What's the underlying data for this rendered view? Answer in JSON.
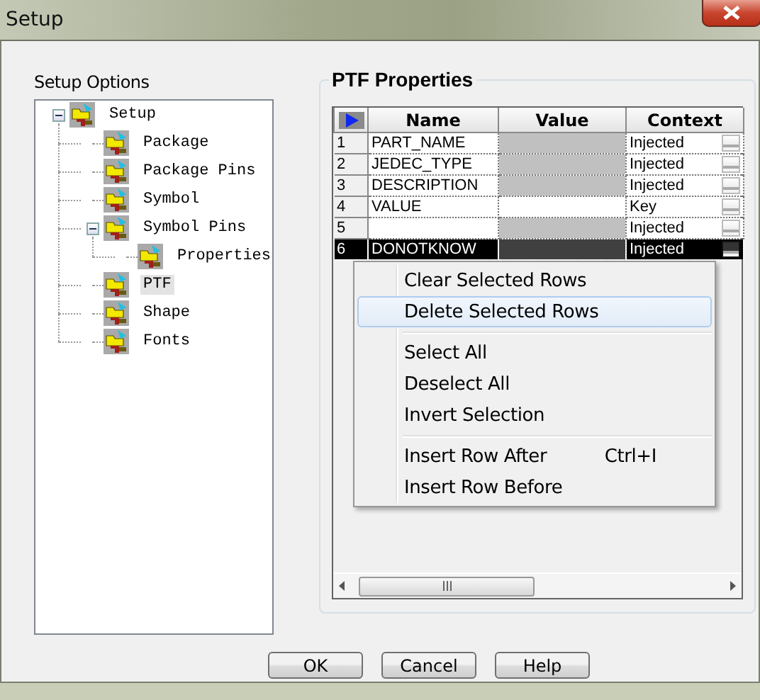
{
  "window": {
    "title": "Setup"
  },
  "setup_options": {
    "label": "Setup Options",
    "tree": [
      {
        "label": "Setup",
        "selected": false,
        "expanded": true,
        "children": [
          {
            "label": "Package",
            "selected": false
          },
          {
            "label": "Package Pins",
            "selected": false
          },
          {
            "label": "Symbol",
            "selected": false
          },
          {
            "label": "Symbol Pins",
            "selected": false,
            "expanded": true,
            "children": [
              {
                "label": "Properties",
                "selected": false
              }
            ]
          },
          {
            "label": "PTF",
            "selected": true
          },
          {
            "label": "Shape",
            "selected": false
          },
          {
            "label": "Fonts",
            "selected": false
          }
        ]
      }
    ]
  },
  "ptf_properties": {
    "title": "PTF Properties",
    "columns": [
      "Name",
      "Value",
      "Context"
    ],
    "rows": [
      {
        "number": "1",
        "name": "PART_NAME",
        "value_disabled": true,
        "context": "Injected",
        "selected": false
      },
      {
        "number": "2",
        "name": "JEDEC_TYPE",
        "value_disabled": true,
        "context": "Injected",
        "selected": false
      },
      {
        "number": "3",
        "name": "DESCRIPTION",
        "value_disabled": true,
        "context": "Injected",
        "selected": false
      },
      {
        "number": "4",
        "name": "VALUE",
        "value_disabled": false,
        "context": "Key",
        "selected": false
      },
      {
        "number": "5",
        "value_disabled": true,
        "context": "Injected",
        "selected": false
      },
      {
        "number": "6",
        "name": "DONOTKNOW",
        "value_disabled": true,
        "context": "Injected",
        "selected": true
      }
    ]
  },
  "context_menu": {
    "items": [
      {
        "kind": "item",
        "label": "Clear Selected Rows",
        "highlighted": false
      },
      {
        "kind": "item",
        "label": "Delete Selected Rows",
        "highlighted": true
      },
      {
        "kind": "separator"
      },
      {
        "kind": "item",
        "label": "Select All",
        "highlighted": false
      },
      {
        "kind": "item",
        "label": "Deselect All",
        "highlighted": false
      },
      {
        "kind": "item",
        "label": "Invert Selection",
        "highlighted": false
      },
      {
        "kind": "separator"
      },
      {
        "kind": "item",
        "label": "Insert Row After",
        "shortcut": "Ctrl+I",
        "highlighted": false
      },
      {
        "kind": "item",
        "label": "Insert Row Before",
        "highlighted": false
      }
    ]
  },
  "buttons": [
    "OK",
    "Cancel",
    "Help"
  ]
}
